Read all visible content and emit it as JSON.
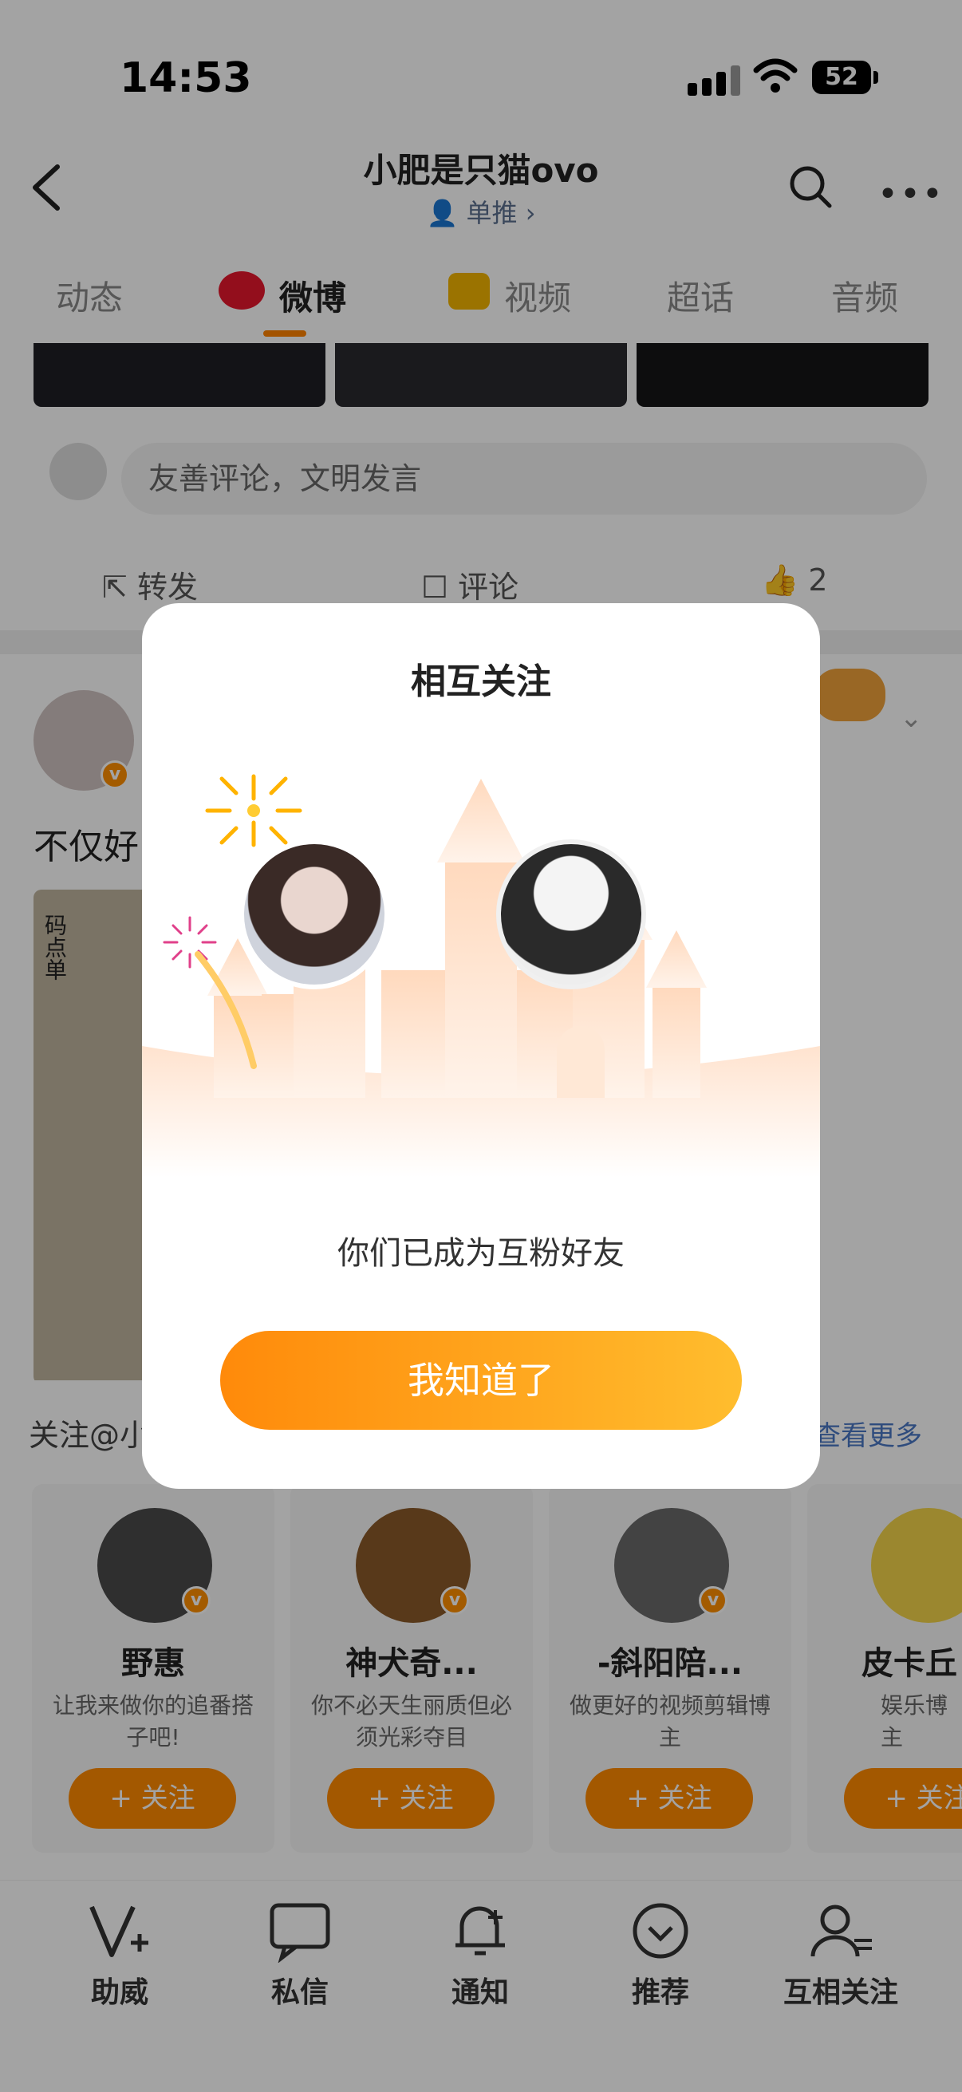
{
  "status": {
    "time": "14:53",
    "battery": "52"
  },
  "header": {
    "title": "小肥是只猫ovo",
    "subtitle": "单推 ›"
  },
  "tabs": [
    {
      "label": "动态",
      "active": false,
      "icon": ""
    },
    {
      "label": "微博",
      "active": true,
      "icon": "weibo-logo-icon"
    },
    {
      "label": "视频",
      "active": false,
      "icon": "video-play-icon"
    },
    {
      "label": "超话",
      "active": false,
      "icon": ""
    },
    {
      "label": "音频",
      "active": false,
      "icon": ""
    }
  ],
  "feed": {
    "comment_placeholder": "友善评论，文明发言",
    "actions": {
      "repost": "转发",
      "comment": "评论",
      "like_count": "2"
    },
    "post_text": "不仅好",
    "image_label": "码点单"
  },
  "recommend": {
    "title": "关注@小",
    "more": "查看更多",
    "cards": [
      {
        "name": "野惠",
        "desc": "让我来做你的追番搭子吧!",
        "follow": "+ 关注",
        "avatar_color": "#4a4a4a"
      },
      {
        "name": "神犬奇...",
        "desc": "你不必天生丽质但必须光彩夺目",
        "follow": "+ 关注",
        "avatar_color": "#8a5a2a"
      },
      {
        "name": "-斜阳陪...",
        "desc": "做更好的视频剪辑博主",
        "follow": "+ 关注",
        "avatar_color": "#6a6a6a"
      },
      {
        "name": "皮卡丘",
        "desc": "娱乐博主",
        "follow": "+ 关注",
        "avatar_color": "#f2d44a"
      }
    ]
  },
  "bottom_nav": [
    {
      "label": "助威",
      "icon": "cheer-v-icon"
    },
    {
      "label": "私信",
      "icon": "message-icon"
    },
    {
      "label": "通知",
      "icon": "bell-plus-icon"
    },
    {
      "label": "推荐",
      "icon": "recommend-icon"
    },
    {
      "label": "互相关注",
      "icon": "mutual-follow-icon"
    }
  ],
  "modal": {
    "title": "相互关注",
    "message": "你们已成为互粉好友",
    "button": "我知道了"
  },
  "colors": {
    "accent": "#ff8200",
    "link": "#4a77c4",
    "verified": "#ff8f00"
  }
}
